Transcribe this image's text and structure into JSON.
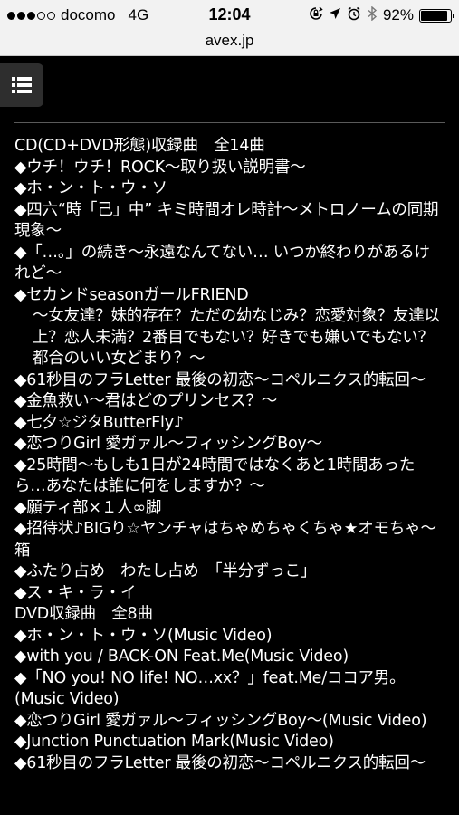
{
  "status_bar": {
    "carrier": "docomo",
    "network": "4G",
    "time": "12:04",
    "battery_text": "92%",
    "battery_level": 0.92
  },
  "browser": {
    "url": "avex.jp"
  },
  "cd_section": {
    "heading": "CD(CD+DVD形態)収録曲　全14曲",
    "tracks": [
      "◆ウチ！ウチ！ROCK～取り扱い説明書～",
      "◆ホ・ン・ト・ウ・ソ",
      "◆四六“時「己」中” キミ時間オレ時計～メトロノームの同期現象～",
      "◆「…。」の続き～永遠なんてない… いつか終わりがあるけれど～",
      "◆セカンドseasonガールFRIEND",
      "～女友達？妹的存在？ただの幼なじみ？恋愛対象？友達以上？恋人未満？2番目でもない？好きでも嫌いでもない？都合のいい女どまり？～",
      "◆61秒目のフラLetter 最後の初恋～コペルニクス的転回～",
      "◆金魚救い～君はどのプリンセス？～",
      "◆七夕☆ジタButterFly♪",
      "◆恋つりGirl 愛ガァル～フィッシングBoy～",
      "◆25時間～もしも1日が24時間ではなくあと1時間あったら…あなたは誰に何をしますか？～",
      "◆願ティ部×１人∞脚",
      "◆招待状♪BIGり☆ヤンチャはちゃめちゃくちゃ★オモちゃ～箱",
      "◆ふたり占め　わたし占め　「半分ずっこ」",
      "◆ス・キ・ラ・イ"
    ]
  },
  "dvd_section": {
    "heading": "DVD収録曲　全8曲",
    "tracks": [
      "◆ホ・ン・ト・ウ・ソ(Music Video)",
      "◆with you / BACK-ON Feat.Me(Music Video)",
      "◆「NO you! NO life! NO…xx？」feat.Me/ココア男。(Music Video)",
      "◆恋つりGirl 愛ガァル～フィッシングBoy～(Music Video)",
      "◆Junction Punctuation Mark(Music Video)",
      "◆61秒目のフラLetter 最後の初恋～コペルニクス的転回～"
    ]
  },
  "colors": {
    "page_background": "#000000",
    "text": "#ffffff",
    "menu_button": "#2e2e2e",
    "divider": "#5a5a5a",
    "browser_chrome": "#f2f2f2"
  }
}
